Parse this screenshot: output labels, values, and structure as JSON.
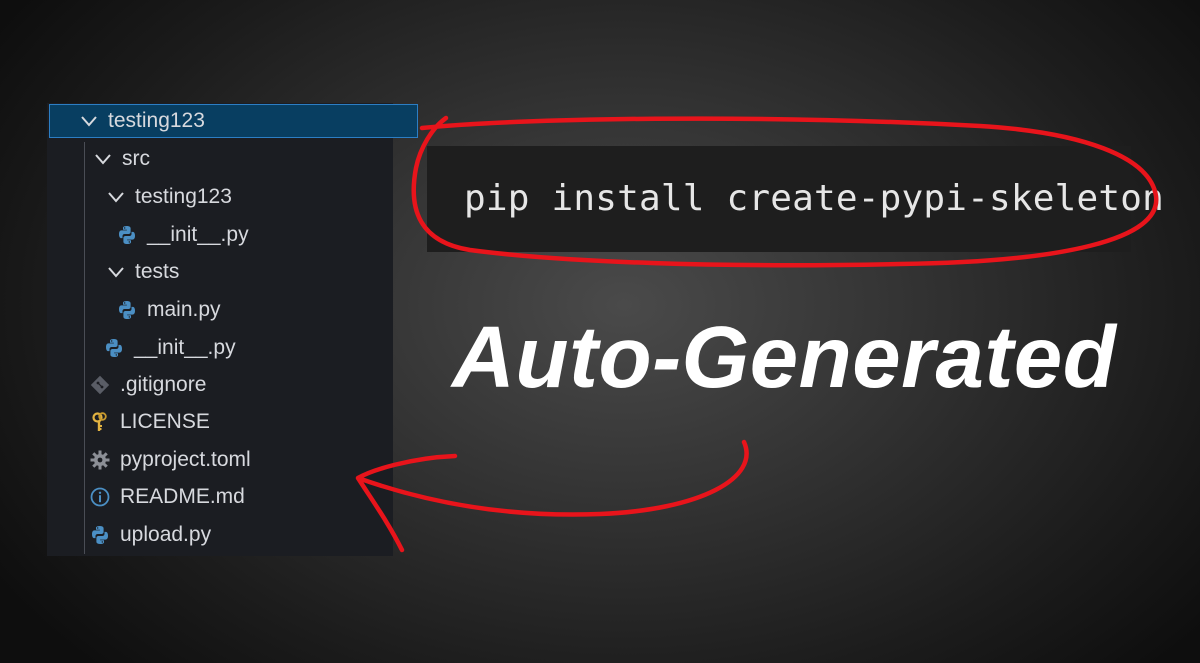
{
  "explorer": {
    "items": [
      {
        "label": "testing123",
        "kind": "folder",
        "expanded": true,
        "icon": "chevron-down-icon"
      },
      {
        "label": "src",
        "kind": "folder",
        "expanded": true,
        "icon": "chevron-down-icon"
      },
      {
        "label": "testing123",
        "kind": "folder",
        "expanded": true,
        "icon": "chevron-down-icon"
      },
      {
        "label": "__init__.py",
        "kind": "file",
        "icon": "python-icon"
      },
      {
        "label": "tests",
        "kind": "folder",
        "expanded": true,
        "icon": "chevron-down-icon"
      },
      {
        "label": "main.py",
        "kind": "file",
        "icon": "python-icon"
      },
      {
        "label": "__init__.py",
        "kind": "file",
        "icon": "python-icon"
      },
      {
        "label": ".gitignore",
        "kind": "file",
        "icon": "git-icon"
      },
      {
        "label": "LICENSE",
        "kind": "file",
        "icon": "key-icon"
      },
      {
        "label": "pyproject.toml",
        "kind": "file",
        "icon": "gear-icon"
      },
      {
        "label": "README.md",
        "kind": "file",
        "icon": "info-icon"
      },
      {
        "label": "upload.py",
        "kind": "file",
        "icon": "python-icon"
      }
    ],
    "selected_index": 0
  },
  "command": {
    "text": "pip install create-pypi-skeleton"
  },
  "headline": {
    "text": "Auto-Generated"
  },
  "colors": {
    "selection_bg": "#083e61",
    "selection_border": "#2c7ec4",
    "annotation_red": "#e8141b",
    "python_blue": "#4b8fc4",
    "key_yellow": "#e3b341"
  }
}
